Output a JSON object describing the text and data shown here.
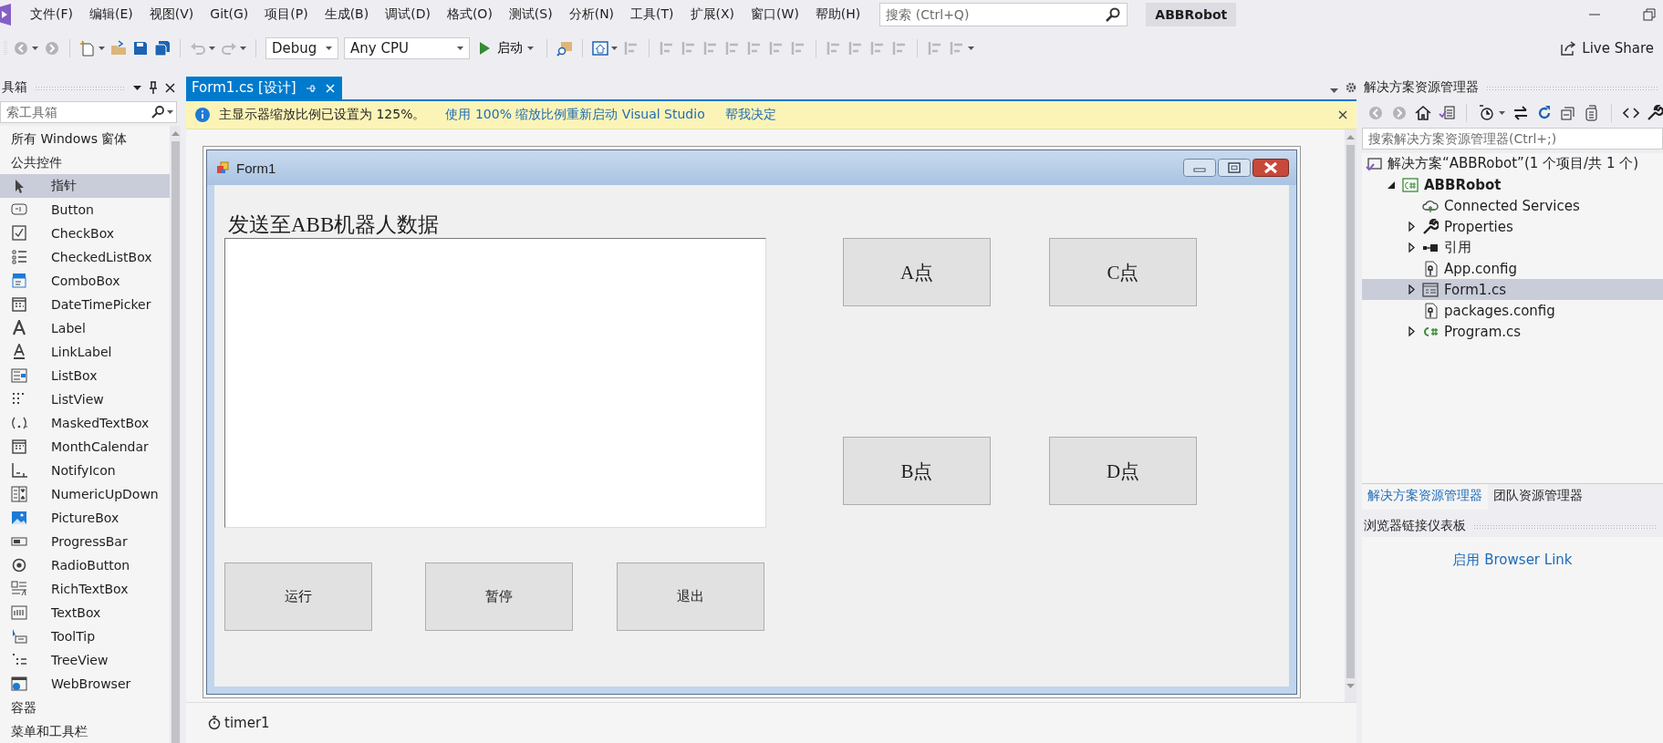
{
  "title_bar": {
    "menu": [
      "文件(F)",
      "编辑(E)",
      "视图(V)",
      "Git(G)",
      "项目(P)",
      "生成(B)",
      "调试(D)",
      "格式(O)",
      "测试(S)",
      "分析(N)",
      "工具(T)",
      "扩展(X)",
      "窗口(W)",
      "帮助(H)"
    ],
    "search": {
      "placeholder": "搜索 (Ctrl+Q)"
    },
    "solution_name": "ABBRobot"
  },
  "toolbar": {
    "configuration": "Debug",
    "platform": "Any CPU",
    "start": "启动",
    "live_share": "Live Share"
  },
  "toolbox": {
    "title": "具箱",
    "search": {
      "placeholder": "索工具箱"
    },
    "entries": [
      {
        "kind": "group",
        "label": "所有 Windows 窗体"
      },
      {
        "kind": "group",
        "label": "公共控件"
      },
      {
        "kind": "tool",
        "label": "指针",
        "selected": true
      },
      {
        "kind": "tool",
        "label": "Button",
        "selected": false
      },
      {
        "kind": "tool",
        "label": "CheckBox",
        "selected": false
      },
      {
        "kind": "tool",
        "label": "CheckedListBox",
        "selected": false
      },
      {
        "kind": "tool",
        "label": "ComboBox",
        "selected": false
      },
      {
        "kind": "tool",
        "label": "DateTimePicker",
        "selected": false
      },
      {
        "kind": "tool",
        "label": "Label",
        "selected": false
      },
      {
        "kind": "tool",
        "label": "LinkLabel",
        "selected": false
      },
      {
        "kind": "tool",
        "label": "ListBox",
        "selected": false
      },
      {
        "kind": "tool",
        "label": "ListView",
        "selected": false
      },
      {
        "kind": "tool",
        "label": "MaskedTextBox",
        "selected": false
      },
      {
        "kind": "tool",
        "label": "MonthCalendar",
        "selected": false
      },
      {
        "kind": "tool",
        "label": "NotifyIcon",
        "selected": false
      },
      {
        "kind": "tool",
        "label": "NumericUpDown",
        "selected": false
      },
      {
        "kind": "tool",
        "label": "PictureBox",
        "selected": false
      },
      {
        "kind": "tool",
        "label": "ProgressBar",
        "selected": false
      },
      {
        "kind": "tool",
        "label": "RadioButton",
        "selected": false
      },
      {
        "kind": "tool",
        "label": "RichTextBox",
        "selected": false
      },
      {
        "kind": "tool",
        "label": "TextBox",
        "selected": false
      },
      {
        "kind": "tool",
        "label": "ToolTip",
        "selected": false
      },
      {
        "kind": "tool",
        "label": "TreeView",
        "selected": false
      },
      {
        "kind": "tool",
        "label": "WebBrowser",
        "selected": false
      },
      {
        "kind": "group",
        "label": "容器"
      },
      {
        "kind": "group",
        "label": "菜单和工具栏"
      }
    ]
  },
  "document_tabs": [
    {
      "label": "Form1.cs [设计]",
      "selected": true
    }
  ],
  "info_bar": {
    "message": "主显示器缩放比例已设置为 125%。",
    "links": [
      "使用 100% 缩放比例重新启动 Visual Studio",
      "帮我决定"
    ]
  },
  "form": {
    "title": "Form1",
    "label": "发送至ABB机器人数据",
    "buttons": [
      "A点",
      "C点",
      "B点",
      "D点",
      "运行",
      "暂停",
      "退出"
    ]
  },
  "component_tray": [
    "timer1"
  ],
  "solution_explorer": {
    "title": "解决方案资源管理器",
    "search": {
      "placeholder": "搜索解决方案资源管理器(Ctrl+;)"
    },
    "tree": [
      {
        "label": "解决方案“ABBRobot”(1 个项目/共 1 个)",
        "selected": false,
        "children": [
          {
            "label": "ABBRobot",
            "selected": false,
            "expanded": true,
            "children": [
              {
                "label": "Connected Services",
                "selected": false
              },
              {
                "label": "Properties",
                "selected": false,
                "expanded": false
              },
              {
                "label": "引用",
                "selected": false,
                "expanded": false
              },
              {
                "label": "App.config",
                "selected": false
              },
              {
                "label": "Form1.cs",
                "selected": true,
                "expanded": false
              },
              {
                "label": "packages.config",
                "selected": false
              },
              {
                "label": "Program.cs",
                "selected": false,
                "expanded": false
              }
            ]
          }
        ]
      }
    ],
    "tabs": [
      {
        "label": "解决方案资源管理器",
        "selected": true
      },
      {
        "label": "团队资源管理器",
        "selected": false
      }
    ]
  },
  "browser_link": {
    "title": "浏览器链接仪表板",
    "link": "启用 Browser Link"
  }
}
